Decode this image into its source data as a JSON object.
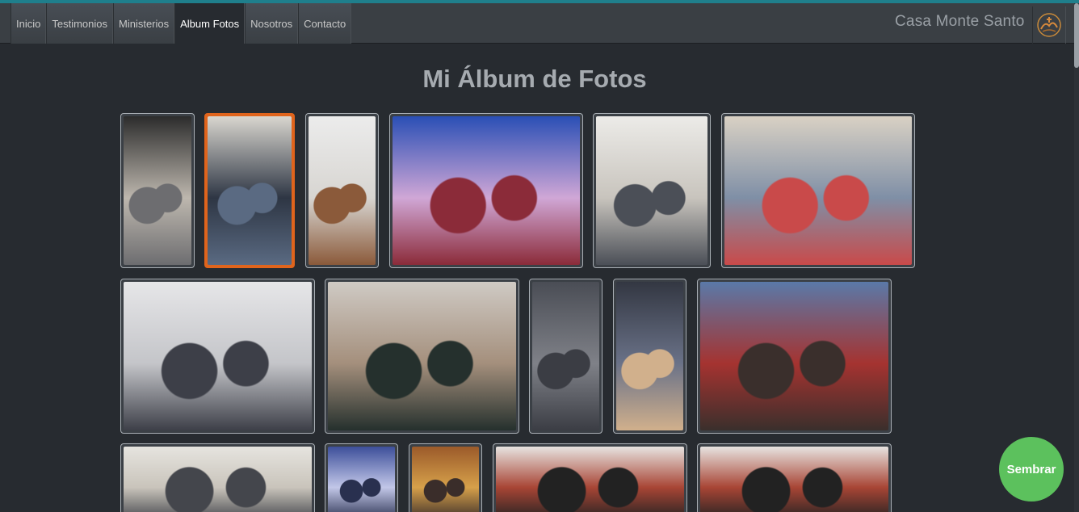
{
  "nav": {
    "items": [
      {
        "label": "Inicio",
        "active": false
      },
      {
        "label": "Testimonios",
        "active": false
      },
      {
        "label": "Ministerios",
        "active": false
      },
      {
        "label": "Album Fotos",
        "active": true
      },
      {
        "label": "Nosotros",
        "active": false
      },
      {
        "label": "Contacto",
        "active": false
      }
    ],
    "brand": "Casa Monte Santo",
    "logo_icon": "church-logo-icon"
  },
  "page": {
    "title": "Mi Álbum de Fotos"
  },
  "photos": [
    {
      "name": "photo-church-entrance",
      "colors": [
        "#2c2c2c",
        "#bdb7ae",
        "#6d6d70"
      ]
    },
    {
      "name": "photo-couple",
      "colors": [
        "#d9d6cf",
        "#2e3644",
        "#5a6a82"
      ]
    },
    {
      "name": "photo-man-pulpit",
      "colors": [
        "#ececec",
        "#d7d5d1",
        "#8b5a3a"
      ]
    },
    {
      "name": "photo-group-selfie-women",
      "colors": [
        "#2a4fb5",
        "#d0a7d6",
        "#8b2b39"
      ]
    },
    {
      "name": "photo-young-group",
      "colors": [
        "#ecebe8",
        "#c8c4bd",
        "#4b4f57"
      ]
    },
    {
      "name": "photo-group-table",
      "colors": [
        "#d9d1c4",
        "#7f8fa6",
        "#c94a4a"
      ]
    },
    {
      "name": "photo-hall-dancing",
      "colors": [
        "#e6e6e8",
        "#c4c5c9",
        "#3d3f48"
      ]
    },
    {
      "name": "photo-sofa-selfie",
      "colors": [
        "#cfcac4",
        "#a48f7c",
        "#25302d"
      ]
    },
    {
      "name": "photo-family-event",
      "colors": [
        "#4a4d55",
        "#7f8188",
        "#3b3d44"
      ]
    },
    {
      "name": "photo-men-event",
      "colors": [
        "#333742",
        "#6a7288",
        "#d1b08c"
      ]
    },
    {
      "name": "photo-group-stage",
      "colors": [
        "#5a79a8",
        "#a53330",
        "#3a2f2c"
      ]
    },
    {
      "name": "photo-office-group",
      "colors": [
        "#e6e4df",
        "#c9c4bb",
        "#44464c"
      ]
    },
    {
      "name": "photo-concert",
      "colors": [
        "#3d4f9a",
        "#c2c7e8",
        "#29304f"
      ]
    },
    {
      "name": "photo-warm-room",
      "colors": [
        "#9b5a2a",
        "#d6a04a",
        "#3a2d2a"
      ]
    },
    {
      "name": "photo-musicians-1",
      "colors": [
        "#e7e3e0",
        "#a84535",
        "#222222"
      ]
    },
    {
      "name": "photo-musicians-2",
      "colors": [
        "#e7e3e0",
        "#a84535",
        "#222222"
      ]
    }
  ],
  "fab": {
    "label": "Sembrar"
  }
}
